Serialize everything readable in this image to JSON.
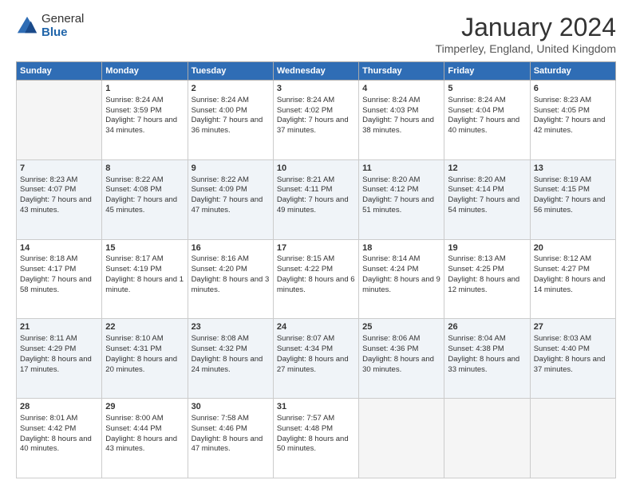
{
  "logo": {
    "general": "General",
    "blue": "Blue"
  },
  "title": "January 2024",
  "subtitle": "Timperley, England, United Kingdom",
  "days_of_week": [
    "Sunday",
    "Monday",
    "Tuesday",
    "Wednesday",
    "Thursday",
    "Friday",
    "Saturday"
  ],
  "weeks": [
    {
      "days": [
        {
          "num": "",
          "empty": true
        },
        {
          "num": "1",
          "sunrise": "8:24 AM",
          "sunset": "3:59 PM",
          "daylight": "7 hours and 34 minutes."
        },
        {
          "num": "2",
          "sunrise": "8:24 AM",
          "sunset": "4:00 PM",
          "daylight": "7 hours and 36 minutes."
        },
        {
          "num": "3",
          "sunrise": "8:24 AM",
          "sunset": "4:02 PM",
          "daylight": "7 hours and 37 minutes."
        },
        {
          "num": "4",
          "sunrise": "8:24 AM",
          "sunset": "4:03 PM",
          "daylight": "7 hours and 38 minutes."
        },
        {
          "num": "5",
          "sunrise": "8:24 AM",
          "sunset": "4:04 PM",
          "daylight": "7 hours and 40 minutes."
        },
        {
          "num": "6",
          "sunrise": "8:23 AM",
          "sunset": "4:05 PM",
          "daylight": "7 hours and 42 minutes."
        }
      ]
    },
    {
      "stripe": true,
      "days": [
        {
          "num": "7",
          "sunrise": "8:23 AM",
          "sunset": "4:07 PM",
          "daylight": "7 hours and 43 minutes."
        },
        {
          "num": "8",
          "sunrise": "8:22 AM",
          "sunset": "4:08 PM",
          "daylight": "7 hours and 45 minutes."
        },
        {
          "num": "9",
          "sunrise": "8:22 AM",
          "sunset": "4:09 PM",
          "daylight": "7 hours and 47 minutes."
        },
        {
          "num": "10",
          "sunrise": "8:21 AM",
          "sunset": "4:11 PM",
          "daylight": "7 hours and 49 minutes."
        },
        {
          "num": "11",
          "sunrise": "8:20 AM",
          "sunset": "4:12 PM",
          "daylight": "7 hours and 51 minutes."
        },
        {
          "num": "12",
          "sunrise": "8:20 AM",
          "sunset": "4:14 PM",
          "daylight": "7 hours and 54 minutes."
        },
        {
          "num": "13",
          "sunrise": "8:19 AM",
          "sunset": "4:15 PM",
          "daylight": "7 hours and 56 minutes."
        }
      ]
    },
    {
      "days": [
        {
          "num": "14",
          "sunrise": "8:18 AM",
          "sunset": "4:17 PM",
          "daylight": "7 hours and 58 minutes."
        },
        {
          "num": "15",
          "sunrise": "8:17 AM",
          "sunset": "4:19 PM",
          "daylight": "8 hours and 1 minute."
        },
        {
          "num": "16",
          "sunrise": "8:16 AM",
          "sunset": "4:20 PM",
          "daylight": "8 hours and 3 minutes."
        },
        {
          "num": "17",
          "sunrise": "8:15 AM",
          "sunset": "4:22 PM",
          "daylight": "8 hours and 6 minutes."
        },
        {
          "num": "18",
          "sunrise": "8:14 AM",
          "sunset": "4:24 PM",
          "daylight": "8 hours and 9 minutes."
        },
        {
          "num": "19",
          "sunrise": "8:13 AM",
          "sunset": "4:25 PM",
          "daylight": "8 hours and 12 minutes."
        },
        {
          "num": "20",
          "sunrise": "8:12 AM",
          "sunset": "4:27 PM",
          "daylight": "8 hours and 14 minutes."
        }
      ]
    },
    {
      "stripe": true,
      "days": [
        {
          "num": "21",
          "sunrise": "8:11 AM",
          "sunset": "4:29 PM",
          "daylight": "8 hours and 17 minutes."
        },
        {
          "num": "22",
          "sunrise": "8:10 AM",
          "sunset": "4:31 PM",
          "daylight": "8 hours and 20 minutes."
        },
        {
          "num": "23",
          "sunrise": "8:08 AM",
          "sunset": "4:32 PM",
          "daylight": "8 hours and 24 minutes."
        },
        {
          "num": "24",
          "sunrise": "8:07 AM",
          "sunset": "4:34 PM",
          "daylight": "8 hours and 27 minutes."
        },
        {
          "num": "25",
          "sunrise": "8:06 AM",
          "sunset": "4:36 PM",
          "daylight": "8 hours and 30 minutes."
        },
        {
          "num": "26",
          "sunrise": "8:04 AM",
          "sunset": "4:38 PM",
          "daylight": "8 hours and 33 minutes."
        },
        {
          "num": "27",
          "sunrise": "8:03 AM",
          "sunset": "4:40 PM",
          "daylight": "8 hours and 37 minutes."
        }
      ]
    },
    {
      "days": [
        {
          "num": "28",
          "sunrise": "8:01 AM",
          "sunset": "4:42 PM",
          "daylight": "8 hours and 40 minutes."
        },
        {
          "num": "29",
          "sunrise": "8:00 AM",
          "sunset": "4:44 PM",
          "daylight": "8 hours and 43 minutes."
        },
        {
          "num": "30",
          "sunrise": "7:58 AM",
          "sunset": "4:46 PM",
          "daylight": "8 hours and 47 minutes."
        },
        {
          "num": "31",
          "sunrise": "7:57 AM",
          "sunset": "4:48 PM",
          "daylight": "8 hours and 50 minutes."
        },
        {
          "num": "",
          "empty": true
        },
        {
          "num": "",
          "empty": true
        },
        {
          "num": "",
          "empty": true
        }
      ]
    }
  ]
}
